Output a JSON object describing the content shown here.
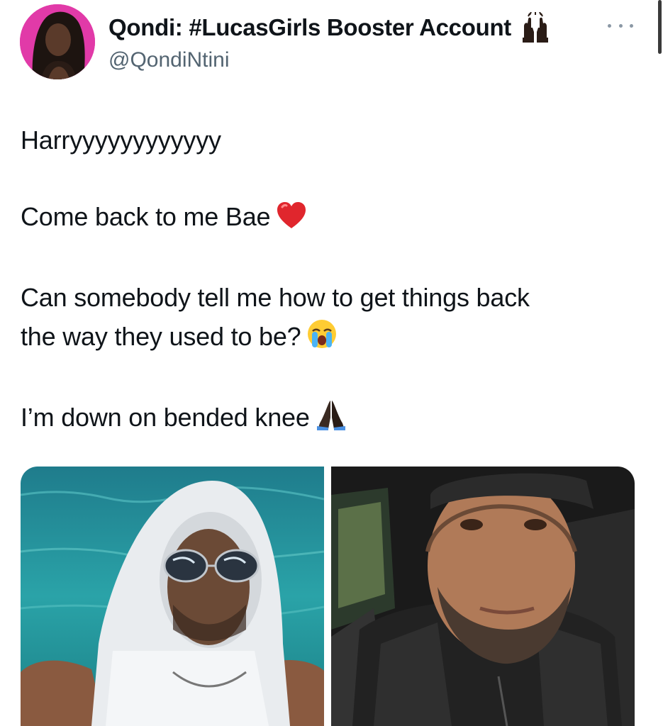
{
  "author": {
    "display_name": "Qondi: #LucasGirls Booster Account",
    "handle": "@QondiNtini",
    "name_emoji": "raising-hands-icon"
  },
  "tweet": {
    "lines": [
      "Harryyyyyyyyyyyy",
      "Come back to me Bae",
      "Can somebody tell me how to get things back",
      "the way they used to be?",
      "I’m down on bended knee"
    ],
    "emojis": [
      "red-heart-icon",
      "loudly-crying-face-icon",
      "folded-hands-icon"
    ]
  },
  "media": [
    {
      "description_icon": "photo-icon",
      "alt": ""
    },
    {
      "description_icon": "photo-icon",
      "alt": ""
    }
  ],
  "colors": {
    "text": "#0f1419",
    "secondary_text": "#536471",
    "avatar_bg": "#e13aa8",
    "background": "#ffffff"
  }
}
